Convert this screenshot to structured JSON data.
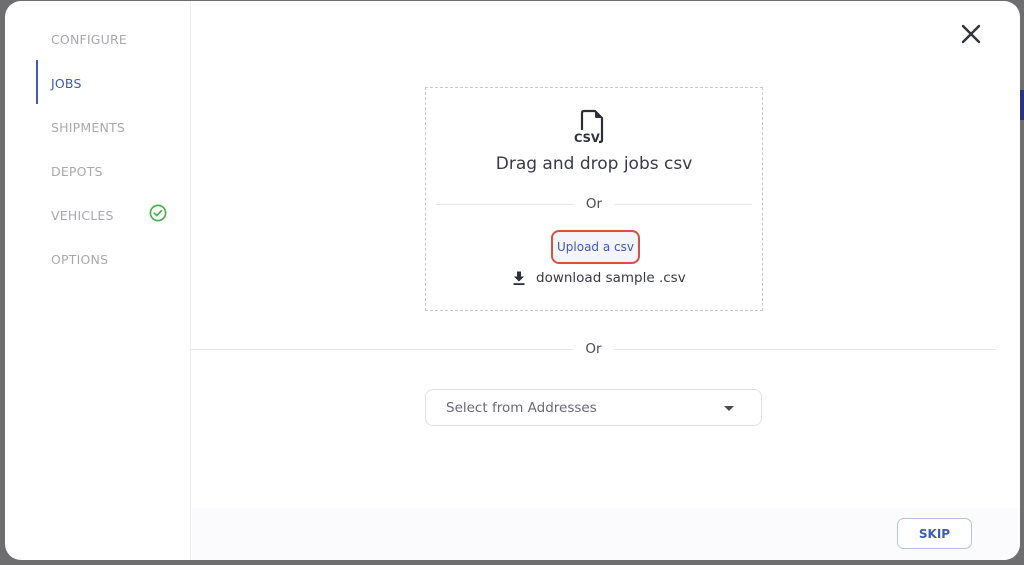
{
  "sidebar": {
    "items": [
      {
        "label": "CONFIGURE",
        "active": false,
        "completed": false
      },
      {
        "label": "JOBS",
        "active": true,
        "completed": false
      },
      {
        "label": "SHIPMENTS",
        "active": false,
        "completed": false
      },
      {
        "label": "DEPOTS",
        "active": false,
        "completed": false
      },
      {
        "label": "VEHICLES",
        "active": false,
        "completed": true
      },
      {
        "label": "OPTIONS",
        "active": false,
        "completed": false
      }
    ]
  },
  "dropzone": {
    "icon": "csv-file-icon",
    "icon_label": "CSV",
    "title": "Drag and drop jobs csv",
    "or_label": "Or",
    "upload_label": "Upload a csv",
    "download_label": "download sample .csv"
  },
  "divider": {
    "or_label": "Or"
  },
  "address_select": {
    "placeholder": "Select from Addresses"
  },
  "footer": {
    "skip_label": "SKIP"
  },
  "colors": {
    "accent": "#3f5cb3",
    "success": "#4caf50",
    "highlight_border": "#d9503f"
  }
}
